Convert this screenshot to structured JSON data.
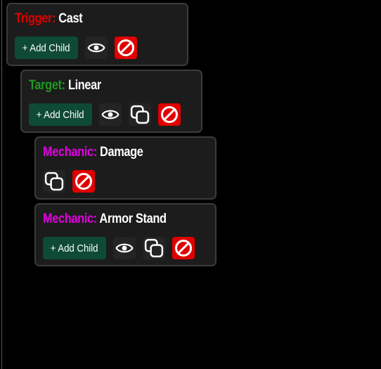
{
  "colors": {
    "trigger": "#e00000",
    "target": "#1f9a1f",
    "mechanic": "#e000e0",
    "add_button_bg": "#0e4a35",
    "delete_button_bg": "#e00000"
  },
  "nodes": [
    {
      "kind_label": "Trigger:",
      "name": "Cast",
      "buttons": [
        "add-child",
        "toggle-visibility",
        "delete"
      ],
      "add_child_label": "+ Add Child"
    },
    {
      "kind_label": "Target:",
      "name": "Linear",
      "buttons": [
        "add-child",
        "toggle-visibility",
        "duplicate",
        "delete"
      ],
      "add_child_label": "+ Add Child"
    },
    {
      "kind_label": "Mechanic:",
      "name": "Damage",
      "buttons": [
        "duplicate",
        "delete"
      ]
    },
    {
      "kind_label": "Mechanic:",
      "name": "Armor Stand",
      "buttons": [
        "add-child",
        "toggle-visibility",
        "duplicate",
        "delete"
      ],
      "add_child_label": "+ Add Child"
    }
  ],
  "icons": {
    "toggle-visibility": "eye-icon",
    "duplicate": "copy-icon",
    "delete": "prohibited-icon"
  }
}
